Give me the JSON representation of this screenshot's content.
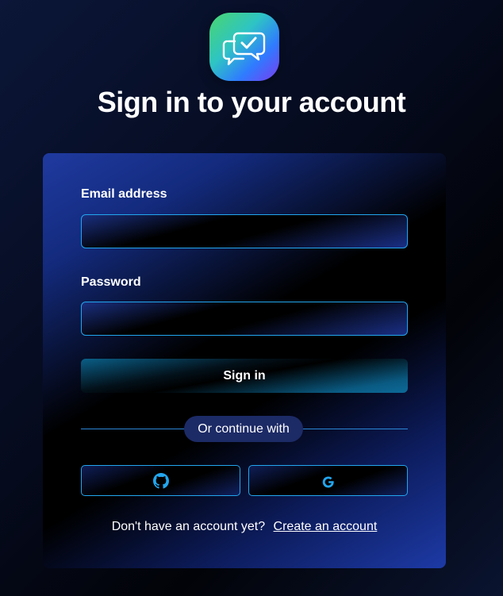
{
  "logo": {
    "icon": "chat-check-icon"
  },
  "page": {
    "title": "Sign in to your account"
  },
  "form": {
    "email_label": "Email address",
    "email_value": "",
    "password_label": "Password",
    "password_value": "",
    "submit_label": "Sign in",
    "divider_text": "Or continue with",
    "social": [
      {
        "provider": "github",
        "icon": "github-icon"
      },
      {
        "provider": "google",
        "icon": "google-icon"
      }
    ],
    "footer_text": "Don't have an account yet?",
    "footer_link": "Create an account"
  },
  "colors": {
    "accent": "#22a6ee",
    "divider_pill": "#1c2a66"
  }
}
